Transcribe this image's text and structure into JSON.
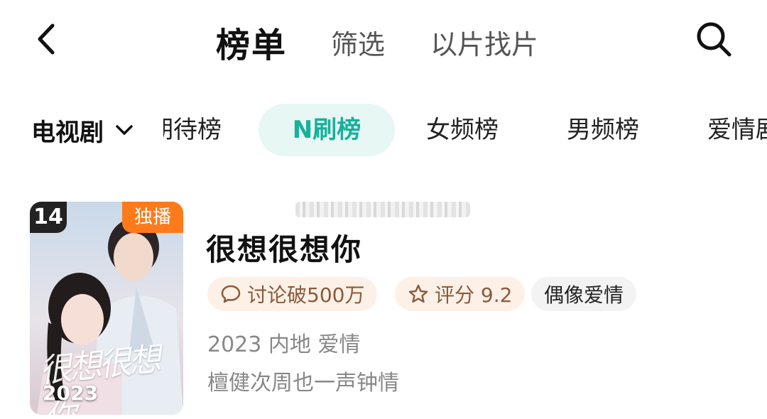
{
  "header": {
    "tabs": [
      "榜单",
      "筛选",
      "以片找片"
    ],
    "active_tab": "榜单"
  },
  "category": {
    "dropdown_label": "电视剧",
    "pills": [
      "期待榜",
      "N刷榜",
      "女频榜",
      "男频榜",
      "爱情剧"
    ],
    "active_pill": "N刷榜"
  },
  "card": {
    "rank": "14",
    "exclusive_badge": "独播",
    "poster_text": "很想很想你",
    "poster_year": "2023",
    "title": "很想很想你",
    "tags": {
      "discuss": "讨论破500万",
      "score": "评分 9.2",
      "genre": "偶像爱情"
    },
    "meta": "2023 内地 爱情",
    "cast": "檀健次周也一声钟情"
  },
  "colors": {
    "accent": "#18b09a",
    "pill_active_bg": "#e6f7f4",
    "badge_orange": "#ff7a1a",
    "tag_bg": "#fdf1e7",
    "tag_text": "#8a5a3a"
  },
  "icons": [
    "back-arrow-icon",
    "search-icon",
    "chevron-down-icon",
    "chat-bubble-icon",
    "star-icon"
  ]
}
